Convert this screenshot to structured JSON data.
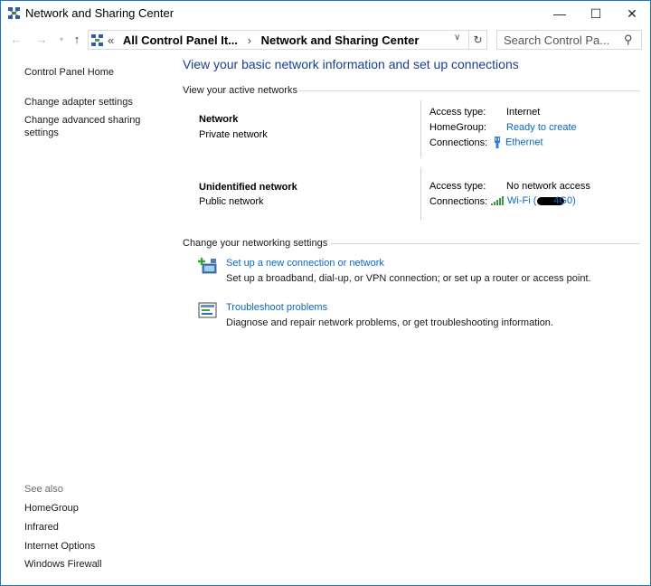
{
  "window": {
    "title": "Network and Sharing Center",
    "minimize_glyph": "—",
    "maximize_glyph": "☐",
    "close_glyph": "✕"
  },
  "nav": {
    "back_glyph": "←",
    "forward_glyph": "→",
    "recent_glyph": "▾",
    "up_glyph": "↑",
    "breadcrumb_chevrons": "«",
    "breadcrumb_parent": "All Control Panel It...",
    "breadcrumb_sep": "›",
    "breadcrumb_current": "Network and Sharing Center",
    "dropdown_glyph": "∨",
    "refresh_glyph": "↻",
    "search_placeholder": "Search Control Pa...",
    "search_glyph": "⚲"
  },
  "sidebar": {
    "home": "Control Panel Home",
    "items": [
      {
        "label": "Change adapter settings"
      },
      {
        "label": "Change advanced sharing settings"
      }
    ],
    "see_also_label": "See also",
    "see_also": [
      {
        "label": "HomeGroup"
      },
      {
        "label": "Infrared"
      },
      {
        "label": "Internet Options"
      },
      {
        "label": "Windows Firewall"
      }
    ]
  },
  "main": {
    "title": "View your basic network information and set up connections",
    "active_heading": "View your active networks",
    "networks": [
      {
        "name": "Network",
        "type": "Private network",
        "access_label": "Access type:",
        "access_value": "Internet",
        "homegroup_label": "HomeGroup:",
        "homegroup_value": "Ready to create",
        "connections_label": "Connections:",
        "connections_value": "Ethernet"
      },
      {
        "name": "Unidentified network",
        "type": "Public network",
        "access_label": "Access type:",
        "access_value": "No network access",
        "connections_label": "Connections:",
        "connections_value": "Wi-Fi (",
        "connections_suffix": "4G0)"
      }
    ],
    "settings_heading": "Change your networking settings",
    "tasks": [
      {
        "link": "Set up a new connection or network",
        "desc": "Set up a broadband, dial-up, or VPN connection; or set up a router or access point."
      },
      {
        "link": "Troubleshoot problems",
        "desc": "Diagnose and repair network problems, or get troubleshooting information."
      }
    ]
  },
  "colors": {
    "accent": "#1a73c7",
    "link": "#0b66c2",
    "heading": "#1a3e8e"
  },
  "icons": {
    "title": "network-center-icon",
    "address": "network-center-icon",
    "ethernet": "ethernet-icon",
    "wifi": "wifi-signal-icon",
    "new_connection": "new-connection-icon",
    "troubleshoot": "troubleshoot-icon"
  }
}
